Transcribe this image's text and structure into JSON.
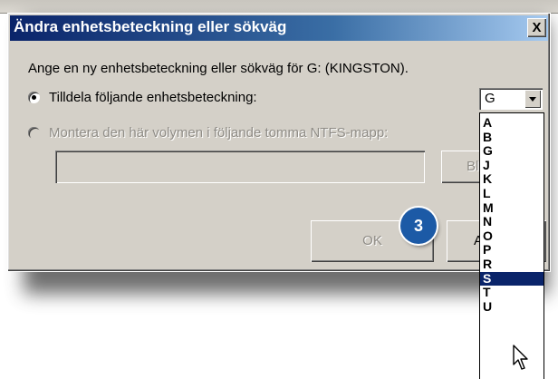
{
  "dialog": {
    "title": "Ändra enhetsbeteckning eller sökväg",
    "close_label": "X",
    "prompt": "Ange en ny enhetsbeteckning eller sökväg för G: (KINGSTON).",
    "option_assign": "Tilldela följande enhetsbeteckning:",
    "option_mount": "Montera den här volymen i följande tomma NTFS-mapp:",
    "mount_path_value": "",
    "browse_label": "Blä",
    "ok_label": "OK",
    "cancel_label": "A",
    "step_badge": "3"
  },
  "drive_select": {
    "value": "G",
    "options": [
      "A",
      "B",
      "G",
      "J",
      "K",
      "L",
      "M",
      "N",
      "O",
      "P",
      "R",
      "S",
      "T",
      "U"
    ],
    "highlighted": "S"
  },
  "colors": {
    "title_gradient_start": "#0a246a",
    "title_gradient_end": "#a6caf0",
    "dialog_face": "#d4d0c8",
    "selection": "#0a246a",
    "badge": "#1c5aa6"
  },
  "icons": [
    "close-icon",
    "radio-selected-icon",
    "radio-unselected-icon",
    "dropdown-arrow-icon",
    "mouse-cursor-icon"
  ]
}
